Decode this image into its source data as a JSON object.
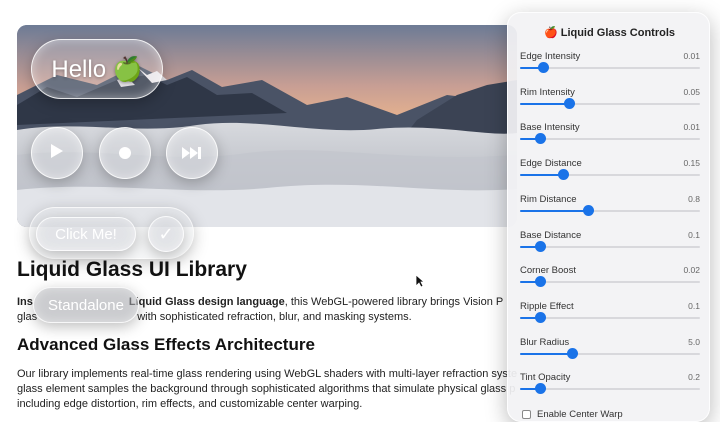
{
  "hero": {
    "hello_label": "Hello 🍏",
    "play_icon": "play-icon",
    "record_icon": "record-icon",
    "next_icon": "skip-forward-icon"
  },
  "buttons": {
    "click_label": "Click Me!",
    "check_icon": "check-icon",
    "check_glyph": "✓",
    "standalone_label": "Standalone"
  },
  "article": {
    "title": "Liquid Glass UI Library",
    "intro_line1_a": "Ins",
    "intro_line1_b": "Liquid Glass design language",
    "intro_line1_c": ", this WebGL-powered library brings Vision P",
    "intro_line2_a": "glas",
    "intro_line2_b": "with sophisticated refraction, blur, and masking systems.",
    "section_title": "Advanced Glass Effects Architecture",
    "para_line1": "Our library implements real-time glass rendering using WebGL shaders with multi-layer refraction syste",
    "para_line2": "glass element samples the background through sophisticated algorithms that simulate physical glass p",
    "para_line3": "including edge distortion, rim effects, and customizable center warping."
  },
  "panel": {
    "title": "🍎 Liquid Glass Controls",
    "accent": "#1a73e8",
    "controls": [
      {
        "label": "Edge Intensity",
        "value": "0.01",
        "level": 0.13
      },
      {
        "label": "Rim Intensity",
        "value": "0.05",
        "level": 0.27
      },
      {
        "label": "Base Intensity",
        "value": "0.01",
        "level": 0.11
      },
      {
        "label": "Edge Distance",
        "value": "0.15",
        "level": 0.24
      },
      {
        "label": "Rim Distance",
        "value": "0.8",
        "level": 0.38
      },
      {
        "label": "Base Distance",
        "value": "0.1",
        "level": 0.11
      },
      {
        "label": "Corner Boost",
        "value": "0.02",
        "level": 0.11
      },
      {
        "label": "Ripple Effect",
        "value": "0.1",
        "level": 0.11
      },
      {
        "label": "Blur Radius",
        "value": "5.0",
        "level": 0.29
      },
      {
        "label": "Tint Opacity",
        "value": "0.2",
        "level": 0.11
      }
    ],
    "checkbox_label": "Enable Center Warp"
  }
}
